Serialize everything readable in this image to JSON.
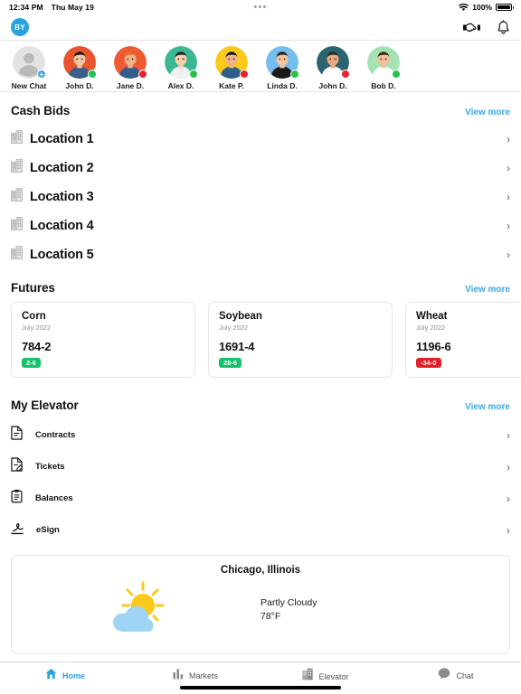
{
  "status_bar": {
    "time": "12:34 PM",
    "date": "Thu May 19",
    "center_dots": "•••",
    "battery_percent": "100%",
    "wifi_icon": "wifi-icon",
    "battery_icon": "battery-full-icon"
  },
  "app_bar": {
    "user_initials": "BY",
    "handshake_icon": "handshake-icon",
    "bell_icon": "bell-icon"
  },
  "chat_strip": {
    "items": [
      {
        "label": "New Chat",
        "type": "new",
        "status": "plus",
        "badge": "+",
        "bg": "#e2e2e2"
      },
      {
        "label": "John D.",
        "type": "avatar",
        "status": "online",
        "bg": "#e8552f"
      },
      {
        "label": "Jane D.",
        "type": "avatar",
        "status": "busy",
        "bg": "#f05a33"
      },
      {
        "label": "Alex D.",
        "type": "avatar",
        "status": "online",
        "bg": "#3bb893"
      },
      {
        "label": "Kate P.",
        "type": "avatar",
        "status": "busy",
        "bg": "#fdc91a"
      },
      {
        "label": "Linda D.",
        "type": "avatar",
        "status": "online",
        "bg": "#74bdec"
      },
      {
        "label": "John D.",
        "type": "avatar",
        "status": "busy",
        "bg": "#2a6470"
      },
      {
        "label": "Bob D.",
        "type": "avatar",
        "status": "online",
        "bg": "#a5e3b4"
      }
    ]
  },
  "cash_bids": {
    "title": "Cash Bids",
    "view_more": "View more",
    "locations": [
      {
        "label": "Location 1"
      },
      {
        "label": "Location 2"
      },
      {
        "label": "Location 3"
      },
      {
        "label": "Location 4"
      },
      {
        "label": "Location 5"
      }
    ]
  },
  "futures": {
    "title": "Futures",
    "view_more": "View more",
    "cards": [
      {
        "name": "Corn",
        "month": "July 2022",
        "price": "784-2",
        "change": "2-6",
        "direction": "up"
      },
      {
        "name": "Soybean",
        "month": "July 2022",
        "price": "1691-4",
        "change": "28-6",
        "direction": "up"
      },
      {
        "name": "Wheat",
        "month": "July 2022",
        "price": "1196-6",
        "change": "-34-0",
        "direction": "down"
      }
    ]
  },
  "my_elevator": {
    "title": "My Elevator",
    "view_more": "View more",
    "items": [
      {
        "label": "Contracts",
        "icon": "document-icon"
      },
      {
        "label": "Tickets",
        "icon": "document-edit-icon"
      },
      {
        "label": "Balances",
        "icon": "clipboard-icon"
      },
      {
        "label": "eSign",
        "icon": "signature-icon"
      }
    ]
  },
  "weather": {
    "city": "Chicago, Illinois",
    "condition": "Partly Cloudy",
    "temperature": "78°F",
    "icon": "sun-behind-cloud-icon"
  },
  "tab_bar": {
    "tabs": [
      {
        "label": "Home",
        "icon": "home-icon",
        "active": true
      },
      {
        "label": "Markets",
        "icon": "bar-chart-icon",
        "active": false
      },
      {
        "label": "Elevator",
        "icon": "building-icon",
        "active": false
      },
      {
        "label": "Chat",
        "icon": "chat-bubble-icon",
        "active": false
      }
    ]
  },
  "colors": {
    "accent": "#29a3e0",
    "link": "#3aa6ec",
    "up": "#15c26b",
    "down": "#e02128"
  }
}
